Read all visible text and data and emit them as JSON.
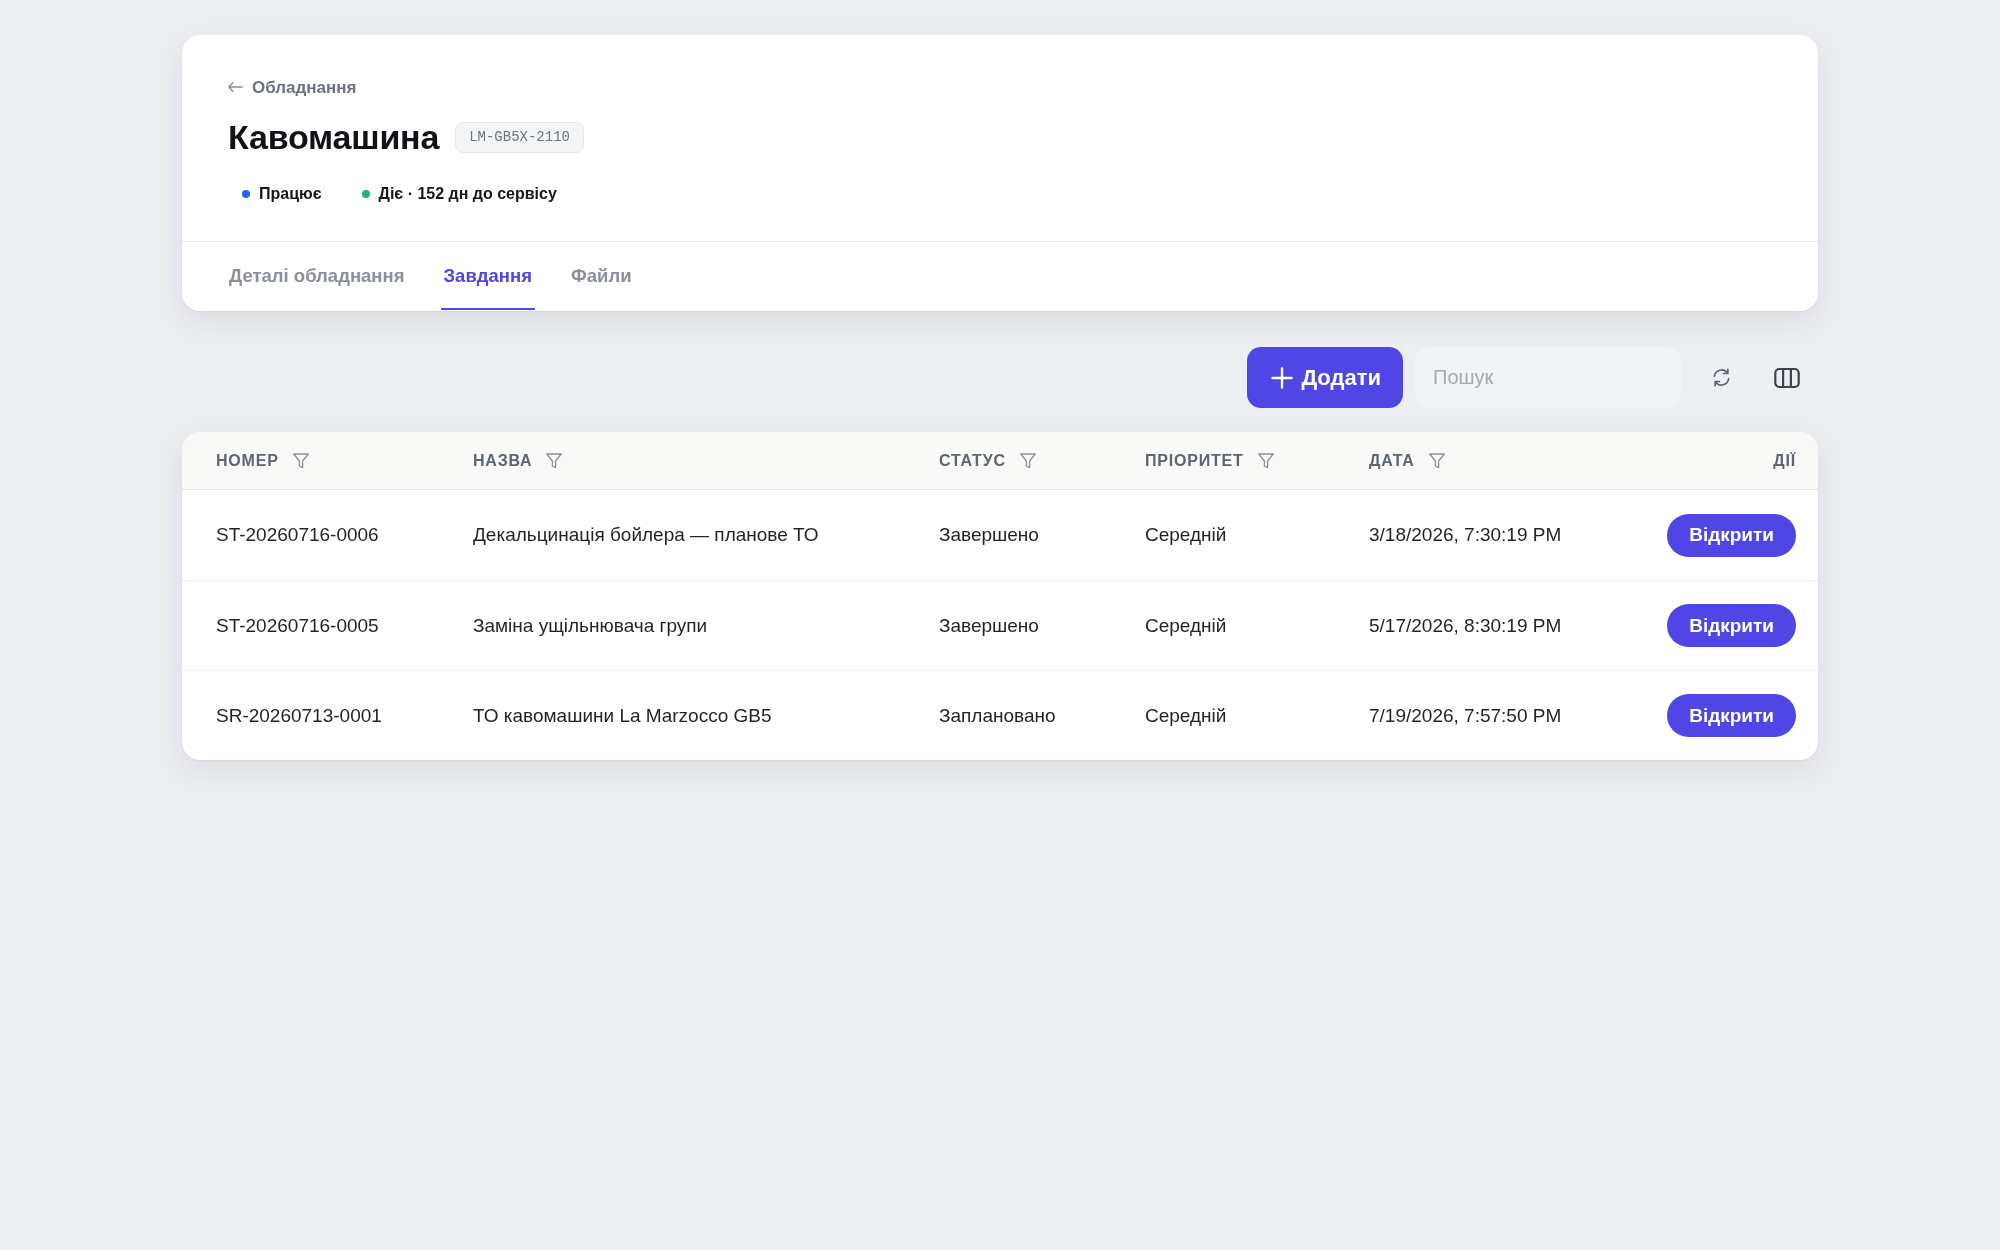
{
  "header": {
    "back_link": "Обладнання",
    "title": "Кавомашина",
    "code": "LM-GB5X-2110",
    "statuses": [
      {
        "label": "Працює",
        "color": "#2563eb"
      },
      {
        "label": "Діє · 152 дн до сервісу",
        "color": "#10b981"
      }
    ],
    "tabs": [
      {
        "label": "Деталі обладнання",
        "selected": false
      },
      {
        "label": "Завдання",
        "selected": true
      },
      {
        "label": "Файли",
        "selected": false
      }
    ]
  },
  "toolbar": {
    "add_button": "Додати",
    "search": {
      "placeholder": "Пошук"
    }
  },
  "table": {
    "columns": [
      {
        "label": "НОМЕР",
        "filterable": true
      },
      {
        "label": "НАЗВА",
        "filterable": true
      },
      {
        "label": "СТАТУС",
        "filterable": true
      },
      {
        "label": "ПРІОРИТЕТ",
        "filterable": true
      },
      {
        "label": "ДАТА",
        "filterable": true
      },
      {
        "label": "ДІЇ",
        "filterable": false
      }
    ],
    "rows": [
      {
        "number": "ST-20260716-0006",
        "title": "Декальцинація бойлера — планове ТО",
        "status": "Завершено",
        "priority": "Середній",
        "date": "3/18/2026, 7:30:19 PM",
        "action": "Відкрити"
      },
      {
        "number": "ST-20260716-0005",
        "title": "Заміна ущільнювача групи",
        "status": "Завершено",
        "priority": "Середній",
        "date": "5/17/2026, 8:30:19 PM",
        "action": "Відкрити"
      },
      {
        "number": "SR-20260713-0001",
        "title": "ТО кавомашини La Marzocco GB5",
        "status": "Заплановано",
        "priority": "Середній",
        "date": "7/19/2026, 7:57:50 PM",
        "action": "Відкрити"
      }
    ]
  }
}
